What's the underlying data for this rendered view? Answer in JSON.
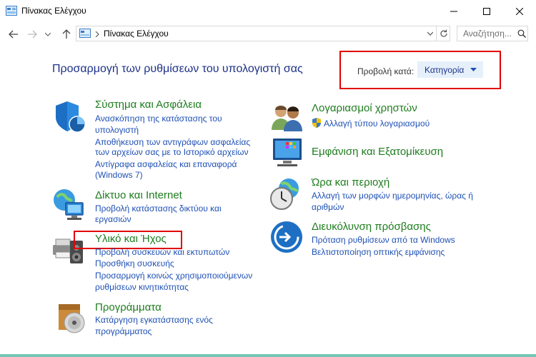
{
  "window": {
    "title": "Πίνακας Ελέγχου",
    "controls": [
      "minimize",
      "maximize",
      "close"
    ]
  },
  "navigation": {
    "address": "Πίνακας Ελέγχου",
    "search_placeholder": "Αναζήτηση..."
  },
  "header": {
    "headline": "Προσαρμογή των ρυθμίσεων του υπολογιστή σας",
    "view_by_label": "Προβολή κατά:",
    "view_by_value": "Κατηγορία"
  },
  "categories_left": [
    {
      "title": "Σύστημα και Ασφάλεια",
      "icon": "shield-icon",
      "links": [
        "Ανασκόπηση της κατάστασης του",
        "υπολογιστή",
        "Αποθήκευση των αντιγράφων ασφαλείας",
        "των αρχείων σας με το Ιστορικό αρχείων",
        "Αντίγραφα ασφαλείας και επαναφορά",
        "(Windows 7)"
      ]
    },
    {
      "title": "Δίκτυο και Internet",
      "icon": "network-globe-icon",
      "links": [
        "Προβολή κατάστασης δικτύου και",
        "εργασιών"
      ]
    },
    {
      "title": "Υλικό και Ήχος",
      "icon": "printer-speaker-icon",
      "links": [
        "Προβολή συσκευών και εκτυπωτών",
        "Προσθήκη συσκευής",
        "Προσαρμογή κοινώς χρησιμοποιούμενων",
        "ρυθμίσεων κινητικότητας"
      ]
    },
    {
      "title": "Προγράμματα",
      "icon": "programs-disc-icon",
      "links": [
        "Κατάργηση εγκατάστασης ενός",
        "προγράμματος"
      ]
    }
  ],
  "categories_right": [
    {
      "title": "Λογαριασμοί χρηστών",
      "icon": "users-icon",
      "links": [
        "Αλλαγή τύπου λογαριασμού"
      ]
    },
    {
      "title": "Εμφάνιση και Εξατομίκευση",
      "icon": "monitor-palette-icon",
      "links": []
    },
    {
      "title": "Ώρα και περιοχή",
      "icon": "clock-globe-icon",
      "links": [
        "Αλλαγή των μορφών ημερομηνίας, ώρας ή",
        "αριθμών"
      ]
    },
    {
      "title": "Διευκόλυνση πρόσβασης",
      "icon": "accessibility-icon",
      "links": [
        "Πρόταση ρυθμίσεων από τα Windows",
        "Βελτιστοποίηση οπτικής εμφάνισης"
      ]
    }
  ],
  "colors": {
    "headline": "#1e3287",
    "category_title": "#1e7d1e",
    "link": "#1e50b4",
    "highlight_box": "#e10000"
  }
}
